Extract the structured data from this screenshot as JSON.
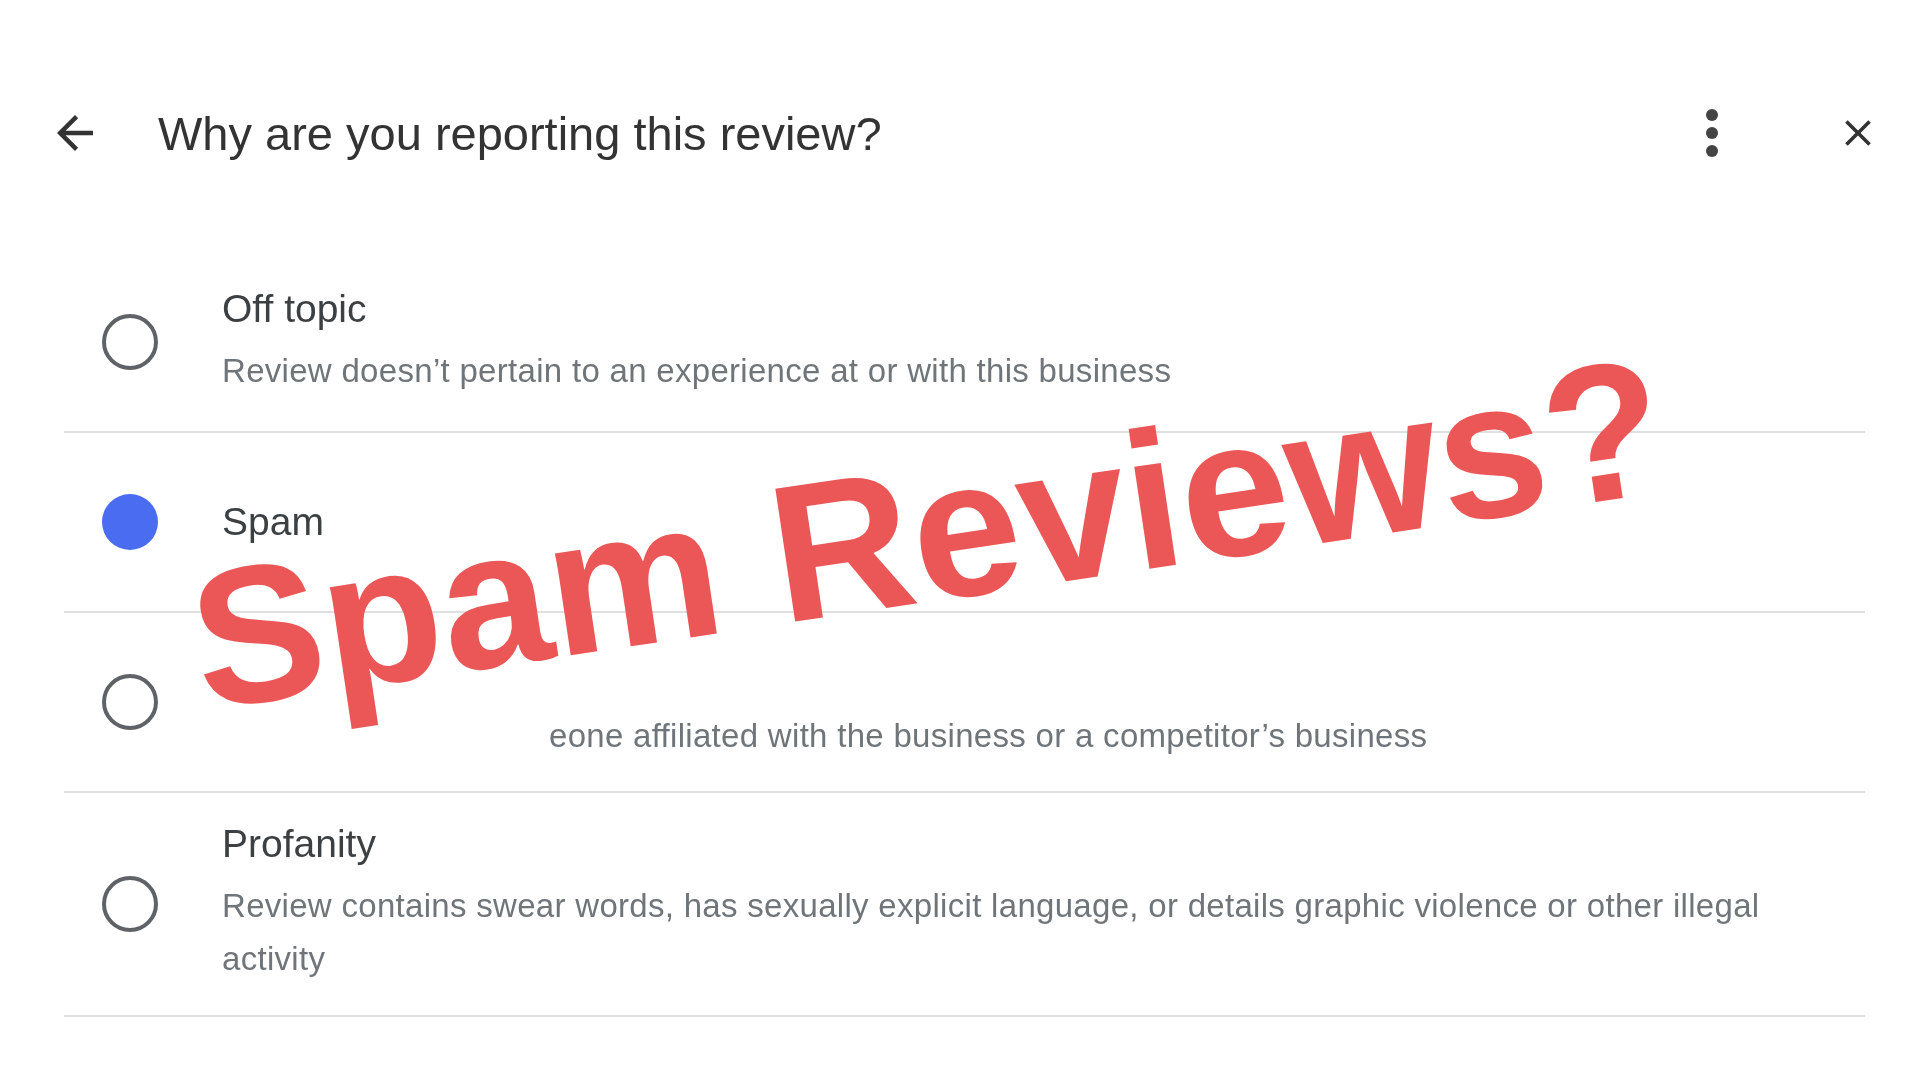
{
  "header": {
    "title": "Why are you reporting this review?"
  },
  "options": [
    {
      "title": "Off topic",
      "description": "Review doesn’t pertain to an experience at or with this business",
      "selected": false
    },
    {
      "title": "Spam",
      "selected": true
    },
    {
      "description": "eone affiliated with the business or a competitor’s business",
      "selected": false
    },
    {
      "title": "Profanity",
      "description": "Review contains swear words, has sexually explicit language, or details graphic violence or other illegal activity",
      "selected": false
    }
  ],
  "overlay": {
    "headline": "Spam Reviews?"
  }
}
